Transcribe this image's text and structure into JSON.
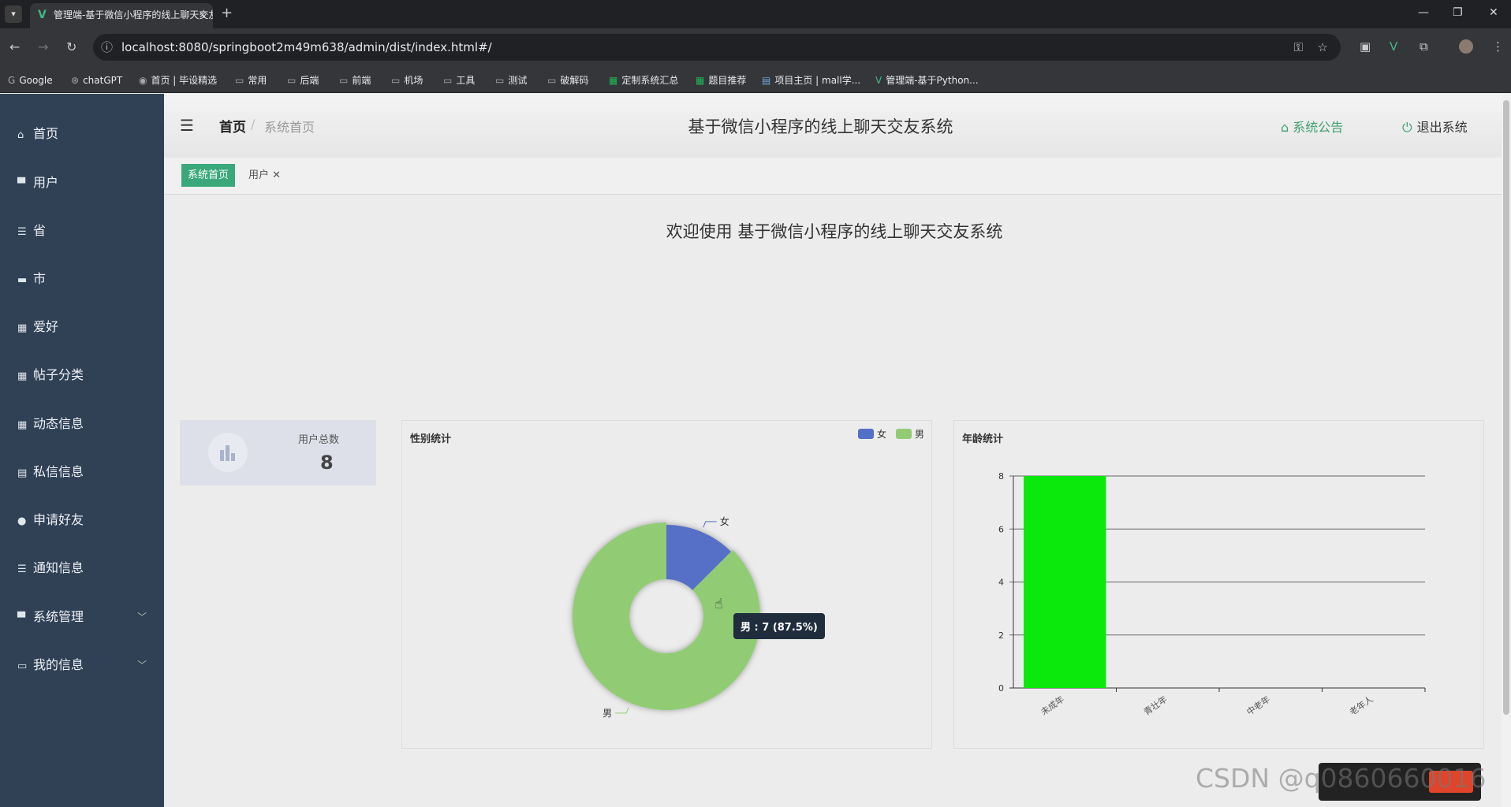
{
  "browser": {
    "tab_title": "管理端-基于微信小程序的线上聊天交友系统",
    "url": "localhost:8080/springboot2m49m638/admin/dist/index.html#/",
    "bookmarks": [
      "Google",
      "chatGPT",
      "首页 | 毕设精选",
      "常用",
      "后端",
      "前端",
      "机场",
      "工具",
      "测试",
      "破解码",
      "定制系统汇总",
      "题目推荐",
      "项目主页 | mall学...",
      "管理端-基于Python..."
    ]
  },
  "sidebar": {
    "items": [
      {
        "label": "首页",
        "icon": "home-icon"
      },
      {
        "label": "用户",
        "icon": "user-icon"
      },
      {
        "label": "省",
        "icon": "sliders-icon"
      },
      {
        "label": "市",
        "icon": "message-icon"
      },
      {
        "label": "爱好",
        "icon": "grid-icon"
      },
      {
        "label": "帖子分类",
        "icon": "grid-icon"
      },
      {
        "label": "动态信息",
        "icon": "grid-icon"
      },
      {
        "label": "私信信息",
        "icon": "clipboard-icon"
      },
      {
        "label": "申请好友",
        "icon": "person-icon"
      },
      {
        "label": "通知信息",
        "icon": "list-icon"
      },
      {
        "label": "系统管理",
        "icon": "monitor-icon"
      },
      {
        "label": "我的信息",
        "icon": "card-icon"
      }
    ]
  },
  "header": {
    "breadcrumb_home": "首页",
    "breadcrumb_sep": "/",
    "breadcrumb_current": "系统首页",
    "title": "基于微信小程序的线上聊天交友系统",
    "notice_label": "系统公告",
    "logout_label": "退出系统"
  },
  "tags": {
    "active": "系统首页",
    "other": "用户"
  },
  "main": {
    "welcome": "欢迎使用 基于微信小程序的线上聊天交友系统",
    "user_total_label": "用户总数",
    "user_total_value": "8"
  },
  "colors": {
    "sidebar_bg": "#304156",
    "accent": "#3aa87a",
    "pie_female": "#5470c6",
    "pie_male": "#91cc75",
    "bar": "#0be80b"
  },
  "chart_data": [
    {
      "type": "pie",
      "title": "性别统计",
      "legend": [
        "女",
        "男"
      ],
      "legend_position": "top-right",
      "slices": [
        {
          "label": "女",
          "value": 1
        },
        {
          "label": "男",
          "value": 7
        }
      ],
      "tooltip": "男 : 7 (87.5%)"
    },
    {
      "type": "bar",
      "title": "年龄统计",
      "categories": [
        "未成年",
        "青壮年",
        "中老年",
        "老年人"
      ],
      "values": [
        8,
        0,
        0,
        0
      ],
      "yticks": [
        "0",
        "2",
        "4",
        "6",
        "8"
      ],
      "ylim": [
        0,
        8
      ],
      "grid": true
    }
  ],
  "watermark": {
    "csdn": "CSDN @q0860660016"
  }
}
